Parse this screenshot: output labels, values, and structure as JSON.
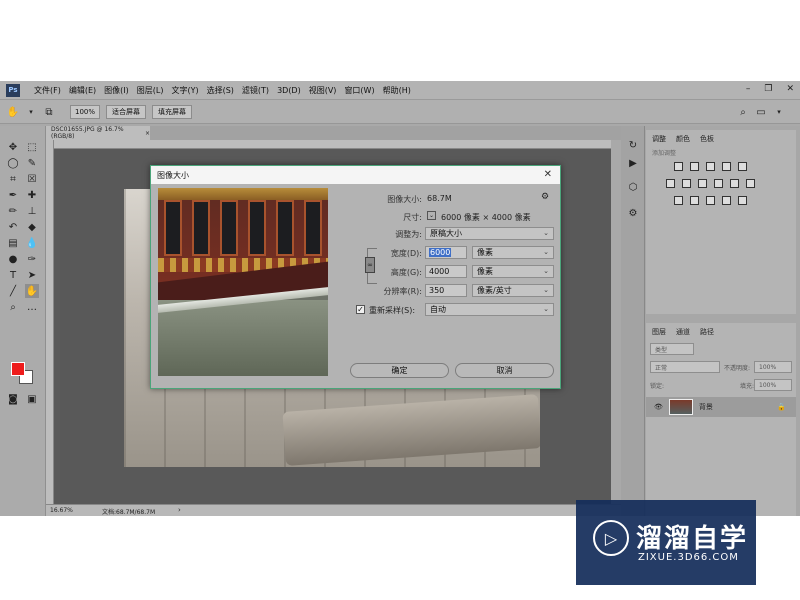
{
  "app": {
    "logo": "Ps",
    "menus": [
      "文件(F)",
      "编辑(E)",
      "图像(I)",
      "图层(L)",
      "文字(Y)",
      "选择(S)",
      "滤镜(T)",
      "3D(D)",
      "视图(V)",
      "窗口(W)",
      "帮助(H)"
    ],
    "window_controls": [
      "–",
      "❐",
      "✕"
    ]
  },
  "options_bar": {
    "zoom_btn": "100%",
    "fit_btn": "适合屏幕",
    "fill_btn": "填充屏幕"
  },
  "document": {
    "tab_title": "DSC01655.JPG @ 16.7%(RGB/8)",
    "tab_close": "×",
    "status_zoom": "16.67%",
    "status_doc": "文档:68.7M/68.7M"
  },
  "adjustments_panel": {
    "tabs": [
      "调整",
      "颜色",
      "色板"
    ],
    "hint": "添加调整"
  },
  "layers_panel": {
    "tabs": [
      "图层",
      "通道",
      "路径"
    ],
    "filter_kind": "类型",
    "blend_mode": "正常",
    "opacity_label": "不透明度:",
    "opacity_value": "100%",
    "lock_label": "锁定:",
    "fill_label": "填充:",
    "fill_value": "100%",
    "layer_name": "背景"
  },
  "dialog": {
    "title": "图像大小",
    "close": "✕",
    "image_size_label": "图像大小:",
    "image_size_value": "68.7M",
    "dimensions_label": "尺寸:",
    "dimensions_value": "6000 像素  ×  4000 像素",
    "fit_to_label": "调整为:",
    "fit_to_value": "原稿大小",
    "width_label": "宽度(D):",
    "width_value": "6000",
    "width_unit": "像素",
    "height_label": "高度(G):",
    "height_value": "4000",
    "height_unit": "像素",
    "resolution_label": "分辨率(R):",
    "resolution_value": "350",
    "resolution_unit": "像素/英寸",
    "resample_label": "重新采样(S):",
    "resample_value": "自动",
    "resample_checked": "✓",
    "ok_label": "确定",
    "cancel_label": "取消"
  },
  "watermark": {
    "title": "溜溜自学",
    "url": "ZIXUE.3D66.COM"
  },
  "colors": {
    "foreground": "#ee1c1c",
    "background": "#ffffff",
    "dialog_border": "#4aa57a",
    "selection": "#3f6fc7"
  }
}
